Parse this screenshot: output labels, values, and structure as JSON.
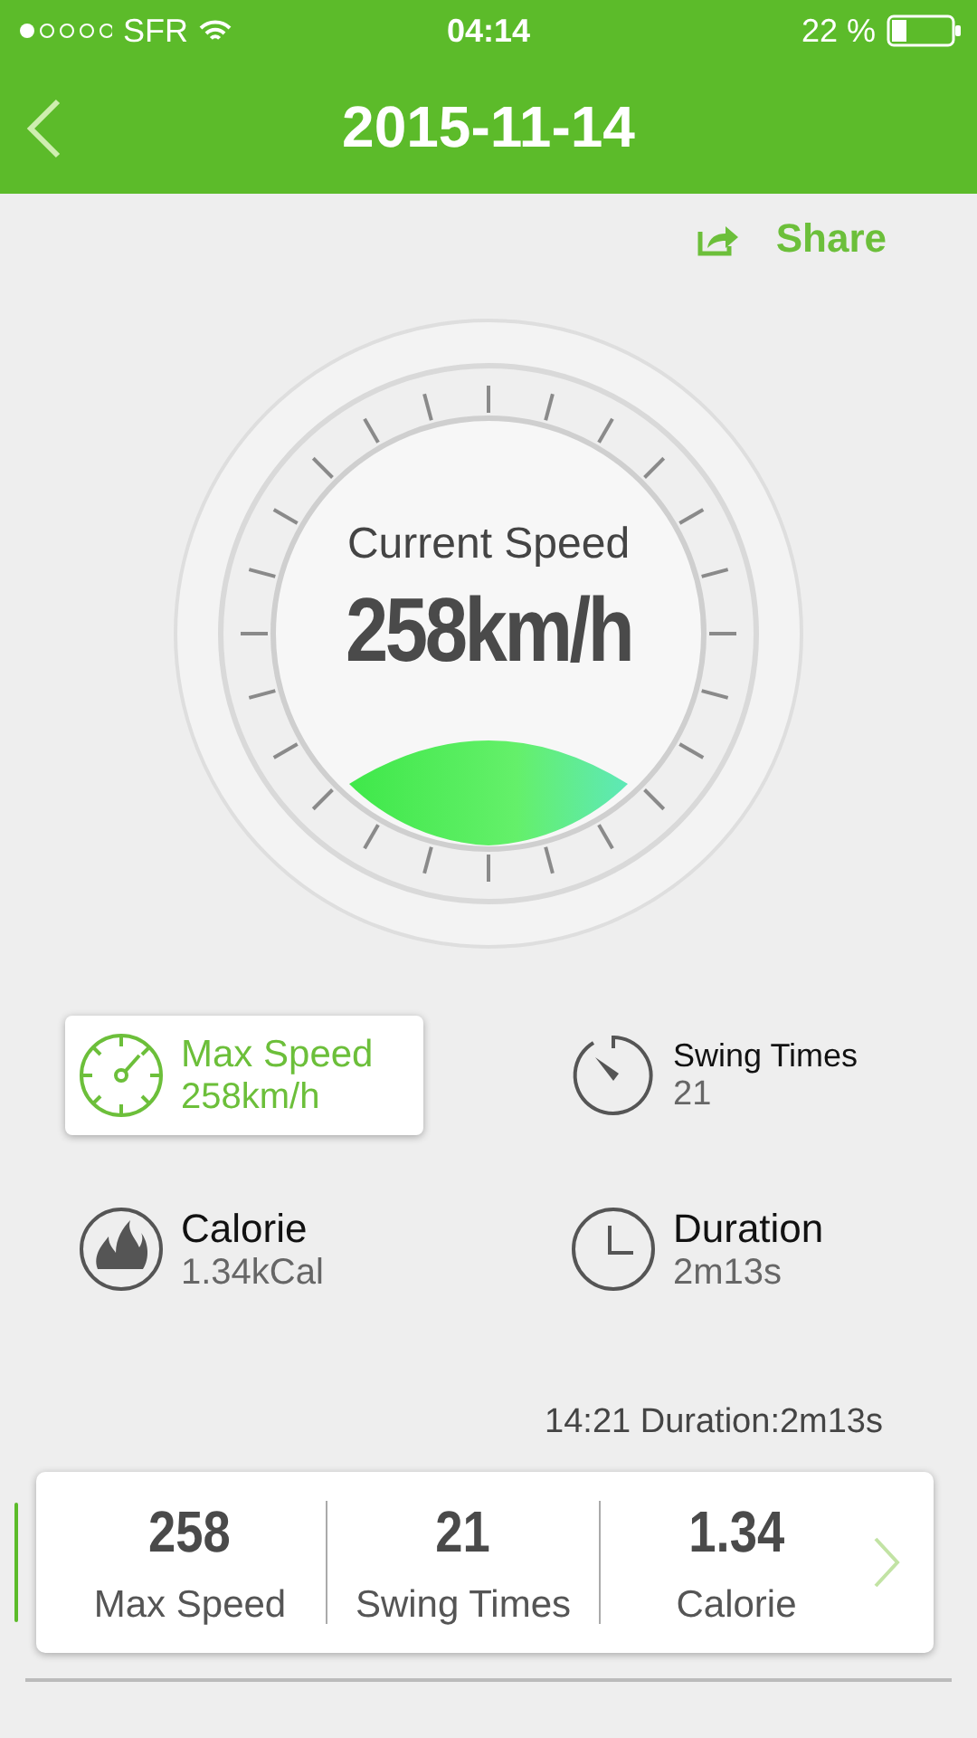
{
  "status_bar": {
    "carrier": "SFR",
    "time": "04:14",
    "battery": "22 %"
  },
  "nav": {
    "title": "2015-11-14"
  },
  "share": {
    "label": "Share"
  },
  "gauge": {
    "label": "Current Speed",
    "value": "258km/h"
  },
  "tiles": [
    {
      "kind": "gauge",
      "label": "Max Speed",
      "value": "258km/h",
      "selected": true
    },
    {
      "kind": "timer",
      "label": "Swing Times",
      "value": "21",
      "selected": false
    },
    {
      "kind": "flame",
      "label": "Calorie",
      "value": "1.34kCal",
      "selected": false
    },
    {
      "kind": "clock",
      "label": "Duration",
      "value": "2m13s",
      "selected": false
    }
  ],
  "session": {
    "summary": "14:21 Duration:2m13s",
    "selected": true,
    "stats": [
      {
        "value": "258",
        "label": "Max Speed"
      },
      {
        "value": "21",
        "label": "Swing Times"
      },
      {
        "value": "1.34",
        "label": "Calorie"
      }
    ]
  }
}
